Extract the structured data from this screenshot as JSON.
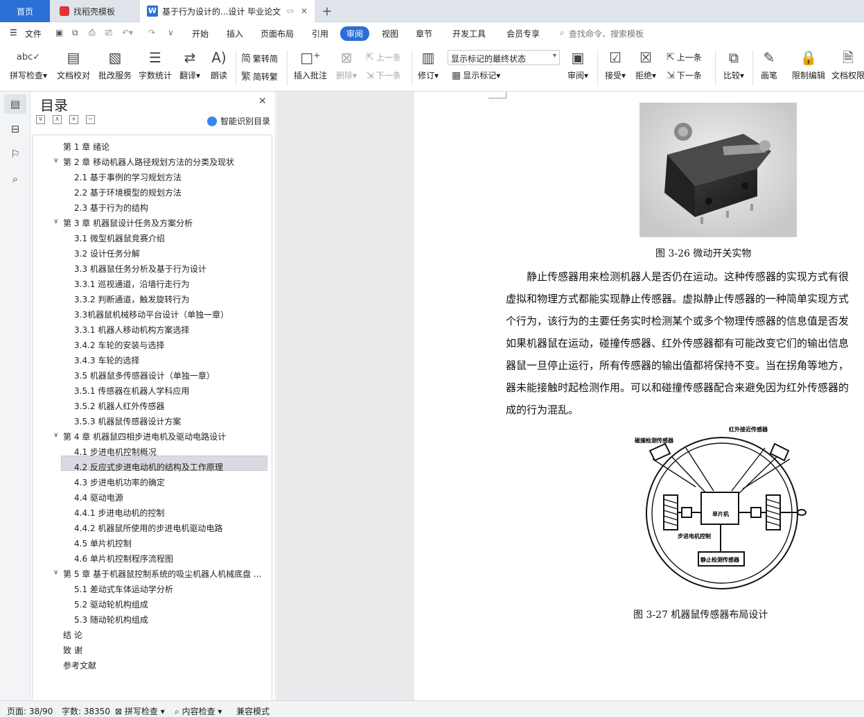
{
  "tabs": {
    "home": "首页",
    "daoke": "找稻壳模板",
    "doc": "基于行为设计的...设计 毕业论文"
  },
  "menubar": {
    "file": "文件",
    "items": [
      "开始",
      "插入",
      "页面布局",
      "引用",
      "审阅",
      "视图",
      "章节",
      "开发工具",
      "会员专享"
    ],
    "active": "审阅",
    "search": "查找命令、搜索模板"
  },
  "ribbon": {
    "spell": "拼写检查",
    "proof": "文档校对",
    "annotate_service": "批改服务",
    "wordcount": "字数统计",
    "translate": "翻译",
    "read": "朗读",
    "to_trad": "繁转简",
    "to_simp": "简转繁",
    "insert_comment": "插入批注",
    "delete": "删除",
    "prev": "上一条",
    "next": "下一条",
    "revise": "修订",
    "markup_state": "显示标记的最终状态",
    "show_markup": "显示标记",
    "review": "审阅",
    "accept": "接受",
    "reject": "拒绝",
    "prev2": "上一条",
    "next2": "下一条",
    "compare": "比较",
    "pen": "画笔",
    "restrict": "限制编辑",
    "doc_perm": "文档权限"
  },
  "nav": {
    "title": "目录",
    "smart": "智能识别目录"
  },
  "toc": [
    {
      "text": "第 1 章   绪论",
      "level": 1,
      "arrow": false
    },
    {
      "text": "第 2 章   移动机器人路径规划方法的分类及现状",
      "level": 1,
      "arrow": true
    },
    {
      "text": "2.1  基于事例的学习规划方法",
      "level": 2
    },
    {
      "text": "2.2  基于环境模型的规划方法",
      "level": 2
    },
    {
      "text": "2.3  基于行为的结构",
      "level": 2
    },
    {
      "text": "第 3 章  机器鼠设计任务及方案分析",
      "level": 1,
      "arrow": true
    },
    {
      "text": "3.1  微型机器鼠竞赛介绍",
      "level": 2
    },
    {
      "text": "3.2  设计任务分解",
      "level": 2
    },
    {
      "text": "3.3  机器鼠任务分析及基于行为设计",
      "level": 2
    },
    {
      "text": "3.3.1  巡视通道，沿墙行走行为",
      "level": 2
    },
    {
      "text": "3.3.2  判断通道，触发旋转行为",
      "level": 2
    },
    {
      "text": "3.3机器鼠机械移动平台设计（单独一章）",
      "level": 2
    },
    {
      "text": "3.3.1  机器人移动机构方案选择",
      "level": 2
    },
    {
      "text": "3.4.2  车轮的安装与选择",
      "level": 2
    },
    {
      "text": "3.4.3  车轮的选择",
      "level": 2
    },
    {
      "text": "3.5  机器鼠多传感器设计（单独一章）",
      "level": 2
    },
    {
      "text": "3.5.1  传感器在机器人学科应用",
      "level": 2
    },
    {
      "text": "3.5.2  机器人红外传感器",
      "level": 2
    },
    {
      "text": "3.5.3 机器鼠传感器设计方案",
      "level": 2,
      "selected": true
    },
    {
      "text": "第 4 章  机器鼠四相步进电机及驱动电路设计",
      "level": 1,
      "arrow": true
    },
    {
      "text": "4.1  步进电机控制概况",
      "level": 2
    },
    {
      "text": "4.2  反应式步进电动机的结构及工作原理",
      "level": 2
    },
    {
      "text": "4.3  步进电机功率的确定",
      "level": 2
    },
    {
      "text": "4.4  驱动电源",
      "level": 2
    },
    {
      "text": "4.4.1  步进电动机的控制",
      "level": 2
    },
    {
      "text": "4.4.2  机器鼠所使用的步进电机驱动电路",
      "level": 2
    },
    {
      "text": "4.5  单片机控制",
      "level": 2
    },
    {
      "text": "4.6  单片机控制程序流程图",
      "level": 2
    },
    {
      "text": "第 5 章  基于机器鼠控制系统的吸尘机器人机械底盘 ...",
      "level": 1,
      "arrow": true
    },
    {
      "text": "5.1 差动式车体运动学分析",
      "level": 2
    },
    {
      "text": "5.2  驱动轮机构组成",
      "level": 2
    },
    {
      "text": "5.3  随动轮机构组成",
      "level": 2
    },
    {
      "text": "结  论",
      "level": 1,
      "arrow": false
    },
    {
      "text": "致  谢",
      "level": 1,
      "arrow": false
    },
    {
      "text": "参考文献",
      "level": 1,
      "arrow": false
    }
  ],
  "document": {
    "fig1_caption": "图 3-26  微动开关实物",
    "paragraph": [
      "静止传感器用来检测机器人是否仍在运动。这种传感器的实现方式有很",
      "虚拟和物理方式都能实现静止传感器。虚拟静止传感器的一种简单实现方式",
      "个行为，该行为的主要任务实时检测某个或多个物理传感器的信息值是否发",
      "如果机器鼠在运动，碰撞传感器、红外传感器都有可能改变它们的输出信息",
      "器鼠一旦停止运行，所有传感器的输出值都将保持不变。当在拐角等地方，",
      "器未能接触时起检测作用。可以和碰撞传感器配合来避免因为红外传感器的",
      "成的行为混乱。"
    ],
    "diagram_labels": {
      "bump": "碰撞检测传感器",
      "ir": "红外接近传感器",
      "mcu": "单片机",
      "stepper": "步进电机控制",
      "stationary": "静止检测传感器"
    },
    "fig2_caption": "图 3-27  机器鼠传感器布局设计"
  },
  "status": {
    "page": "页面: 38/90",
    "words": "字数: 38350",
    "spell": "拼写检查",
    "content": "内容检查",
    "compat": "兼容模式"
  }
}
